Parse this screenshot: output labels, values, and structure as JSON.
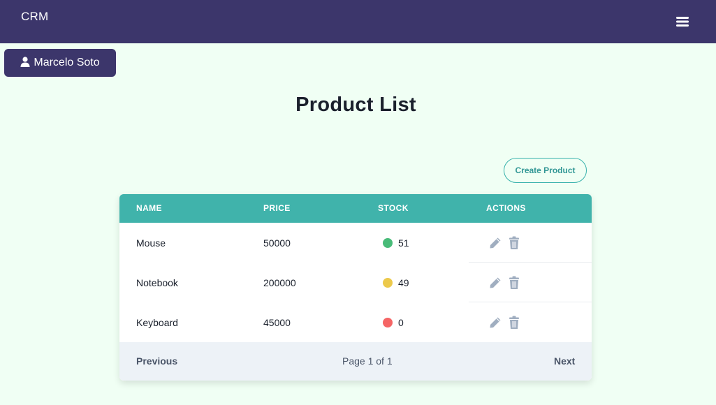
{
  "app": {
    "brand": "CRM"
  },
  "user": {
    "name": "Marcelo Soto"
  },
  "page": {
    "title": "Product List"
  },
  "toolbar": {
    "create_label": "Create Product"
  },
  "table": {
    "headers": {
      "name": "NAME",
      "price": "PRICE",
      "stock": "STOCK",
      "actions": "ACTIONS"
    },
    "rows": [
      {
        "name": "Mouse",
        "price": "50000",
        "stock": "51",
        "status_color": "#48bb78"
      },
      {
        "name": "Notebook",
        "price": "200000",
        "stock": "49",
        "status_color": "#ecc94b"
      },
      {
        "name": "Keyboard",
        "price": "45000",
        "stock": "0",
        "status_color": "#f56565"
      }
    ]
  },
  "pagination": {
    "previous": "Previous",
    "page_label": "Page 1 of 1",
    "next": "Next"
  },
  "icons": {
    "menu": "menu-icon",
    "user": "user-icon",
    "edit": "pencil-icon",
    "delete": "trash-icon"
  },
  "colors": {
    "header_bg": "#3c366b",
    "page_bg": "#f0fff4",
    "table_head_bg": "#40b3ab",
    "accent": "#38b2ac"
  }
}
